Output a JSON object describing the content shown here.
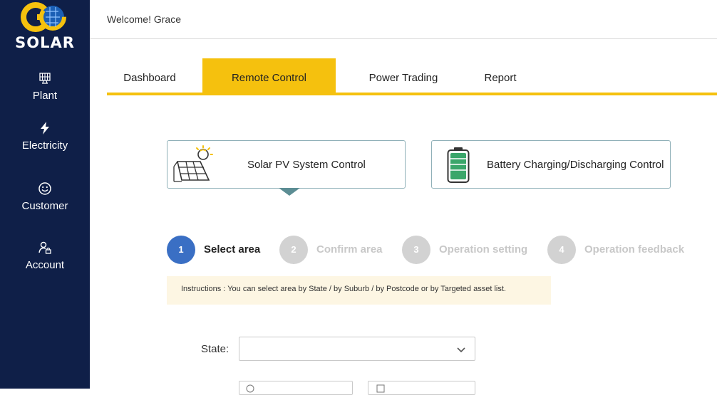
{
  "sidebar": {
    "logo_text": "SOLAR",
    "logo_letters": "GC",
    "items": [
      {
        "label": "Plant",
        "icon": "solar-panel-icon"
      },
      {
        "label": "Electricity",
        "icon": "lightning-icon"
      },
      {
        "label": "Customer",
        "icon": "smiley-icon"
      },
      {
        "label": "Account",
        "icon": "user-lock-icon"
      }
    ]
  },
  "header": {
    "welcome": "Welcome! Grace"
  },
  "tabs": [
    {
      "label": "Dashboard",
      "active": false
    },
    {
      "label": "Remote Control",
      "active": true
    },
    {
      "label": "Power Trading",
      "active": false
    },
    {
      "label": "Report",
      "active": false
    }
  ],
  "control_cards": [
    {
      "label": "Solar PV System Control",
      "icon": "solar-pv-icon",
      "selected": true
    },
    {
      "label": "Battery Charging/Discharging Control",
      "icon": "battery-icon",
      "selected": false
    }
  ],
  "steps": [
    {
      "number": "1",
      "label": "Select area",
      "active": true
    },
    {
      "number": "2",
      "label": "Confirm area",
      "active": false
    },
    {
      "number": "3",
      "label": "Operation setting",
      "active": false
    },
    {
      "number": "4",
      "label": "Operation feedback",
      "active": false
    }
  ],
  "instructions": "Instructions : You can select area by State / by Suburb / by Postcode  or by Targeted asset list.",
  "form": {
    "state_label": "State",
    "state_colon": ":",
    "state_value": ""
  },
  "colors": {
    "sidebar_bg": "#0f1f48",
    "accent": "#f5c10e",
    "step_active": "#3a6fc4",
    "step_inactive": "#d2d2d2"
  }
}
